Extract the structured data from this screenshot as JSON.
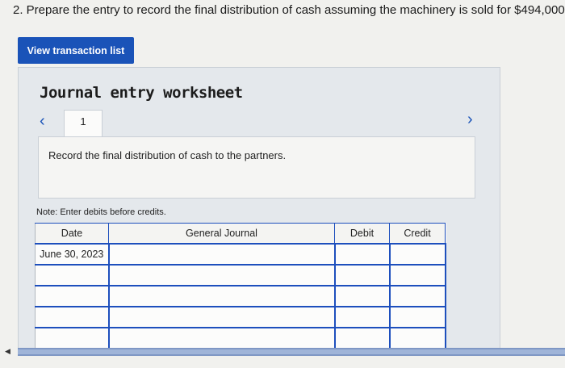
{
  "question": {
    "text": "2. Prepare the entry to record the final distribution of cash assuming the machinery is sold for $494,000."
  },
  "toolbar": {
    "view_transactions_label": "View transaction list"
  },
  "worksheet": {
    "title": "Journal entry worksheet",
    "prev_icon": "chevron-left-icon",
    "next_icon": "chevron-right-icon",
    "tabs": [
      {
        "label": "1"
      }
    ],
    "instruction": "Record the final distribution of cash to the partners.",
    "note": "Note: Enter debits before credits."
  },
  "journal": {
    "headers": {
      "date": "Date",
      "account": "General Journal",
      "debit": "Debit",
      "credit": "Credit"
    },
    "rows": [
      {
        "date": "June 30, 2023",
        "account": "",
        "debit": "",
        "credit": ""
      },
      {
        "date": "",
        "account": "",
        "debit": "",
        "credit": ""
      },
      {
        "date": "",
        "account": "",
        "debit": "",
        "credit": ""
      },
      {
        "date": "",
        "account": "",
        "debit": "",
        "credit": ""
      },
      {
        "date": "",
        "account": "",
        "debit": "",
        "credit": ""
      }
    ]
  },
  "colors": {
    "accent": "#1a53b8",
    "panel": "#e4e8ec",
    "cell_border": "#1d4fbd"
  }
}
